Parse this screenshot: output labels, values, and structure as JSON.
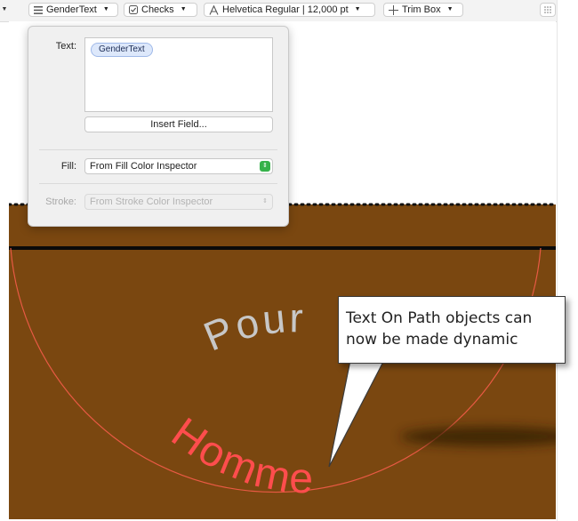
{
  "toolbar": {
    "gender_field": "GenderText",
    "checks": "Checks",
    "font": "Helvetica Regular | 12,000 pt",
    "trim_box": "Trim Box"
  },
  "popover": {
    "text_label": "Text:",
    "text_token": "GenderText",
    "insert_field": "Insert Field...",
    "fill_label": "Fill:",
    "fill_value": "From Fill Color Inspector",
    "stroke_label": "Stroke:",
    "stroke_value": "From Stroke Color Inspector"
  },
  "canvas": {
    "text_pour": "Pour",
    "text_homme": "Homme",
    "colors": {
      "background": "#7a4710",
      "arc": "#e85a44",
      "homme": "#ff4d4d",
      "pour": "#c7c7c7"
    }
  },
  "callout": {
    "line1": "Text On Path objects can",
    "line2": "now be made dynamic"
  }
}
